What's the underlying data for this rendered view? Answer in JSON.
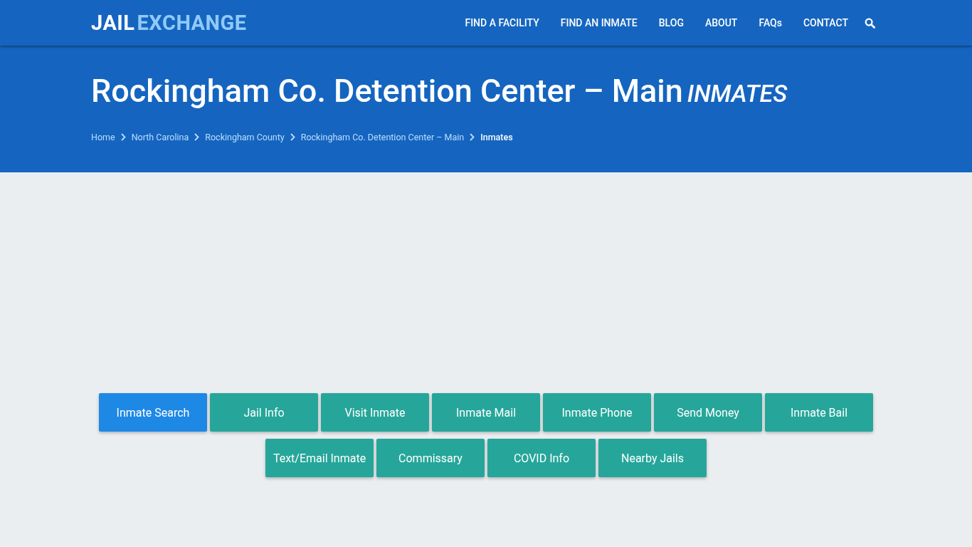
{
  "logo": {
    "part_1": "JAIL",
    "part_2": "EXCHANGE"
  },
  "nav": [
    "FIND A FACILITY",
    "FIND AN INMATE",
    "BLOG",
    "ABOUT",
    "FAQs",
    "CONTACT"
  ],
  "hero": {
    "title": "Rockingham Co. Detention Center – Main",
    "subtitle": "INMATES"
  },
  "breadcrumbs": [
    {
      "label": "Home",
      "kind": "link"
    },
    {
      "label": "North Carolina",
      "kind": "link"
    },
    {
      "label": "Rockingham County",
      "kind": "link"
    },
    {
      "label": "Rockingham Co. Detention Center – Main",
      "kind": "link"
    },
    {
      "label": "Inmates",
      "kind": "current"
    }
  ],
  "button_rows": [
    [
      {
        "label": "Inmate Search",
        "selected": true
      },
      {
        "label": "Jail Info",
        "selected": false
      },
      {
        "label": "Visit Inmate",
        "selected": false
      },
      {
        "label": "Inmate Mail",
        "selected": false
      },
      {
        "label": "Inmate Phone",
        "selected": false
      },
      {
        "label": "Send Money",
        "selected": false
      },
      {
        "label": "Inmate Bail",
        "selected": false
      }
    ],
    [
      {
        "label": "Text/Email Inmate",
        "selected": false
      },
      {
        "label": "Commissary",
        "selected": false
      },
      {
        "label": "COVID Info",
        "selected": false
      },
      {
        "label": "Nearby Jails",
        "selected": false
      }
    ]
  ]
}
